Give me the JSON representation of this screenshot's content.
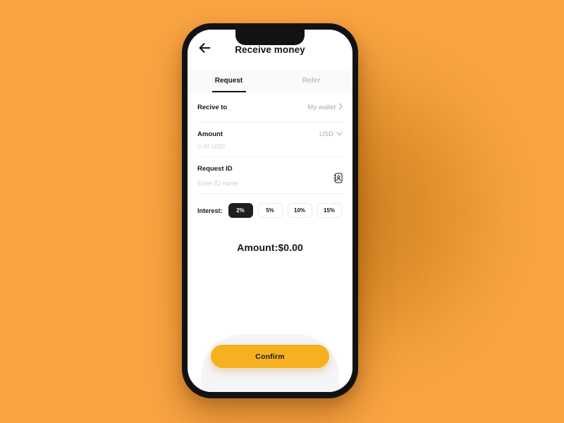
{
  "theme": {
    "background": "#F9A443",
    "accent": "#F5B120",
    "dark": "#1E1E22",
    "muted": "#A9AAAE"
  },
  "phone": {
    "appbar": {
      "back_icon": "arrow-left-icon",
      "title": "Receive money"
    },
    "tabs": [
      {
        "label": "Request",
        "active": true
      },
      {
        "label": "Refer",
        "active": false
      }
    ],
    "fields": {
      "receive_to": {
        "label": "Recive to",
        "value": "My wallet",
        "chevron": "chevron-right-icon"
      },
      "amount": {
        "label": "Amount",
        "currency": "USD",
        "currency_chevron": "chevron-down-icon",
        "placeholder": "0.00 USD",
        "value": ""
      },
      "request_id": {
        "label": "Request ID",
        "placeholder": "Enter ID name",
        "value": "",
        "icon": "contact-book-icon"
      }
    },
    "interest": {
      "label": "Interest:",
      "options": [
        {
          "label": "2%",
          "selected": true
        },
        {
          "label": "5%",
          "selected": false
        },
        {
          "label": "10%",
          "selected": false
        },
        {
          "label": "15%",
          "selected": false
        }
      ]
    },
    "total": "Amount:$0.00",
    "confirm_label": "Confirm"
  }
}
